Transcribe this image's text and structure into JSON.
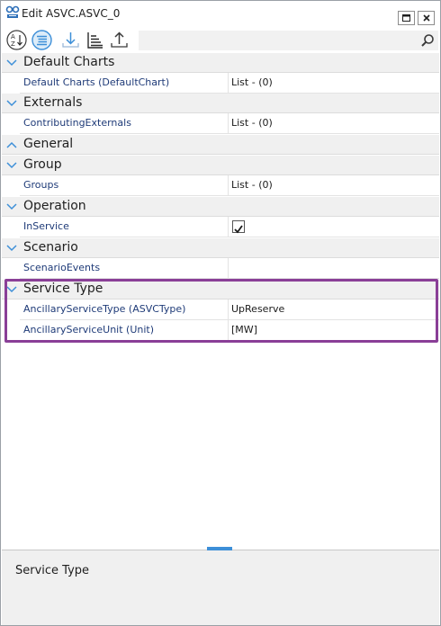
{
  "window": {
    "title": "Edit ASVC.ASVC_0"
  },
  "toolbar": {
    "buttons": [
      "sort-alphabetical",
      "sort-categorized",
      "download",
      "hierarchy",
      "upload"
    ],
    "search": {
      "placeholder": "",
      "value": ""
    }
  },
  "categories": [
    {
      "label": "Default Charts",
      "expanded": true,
      "rows": [
        {
          "name": "Default Charts (DefaultChart)",
          "value": "List - (0)"
        }
      ]
    },
    {
      "label": "Externals",
      "expanded": true,
      "rows": [
        {
          "name": "ContributingExternals",
          "value": "List - (0)"
        }
      ]
    },
    {
      "label": "General",
      "expanded": false,
      "rows": []
    },
    {
      "label": "Group",
      "expanded": true,
      "rows": [
        {
          "name": "Groups",
          "value": "List - (0)"
        }
      ]
    },
    {
      "label": "Operation",
      "expanded": true,
      "rows": [
        {
          "name": "InService",
          "value": "",
          "checked": true
        }
      ]
    },
    {
      "label": "Scenario",
      "expanded": true,
      "rows": [
        {
          "name": "ScenarioEvents",
          "value": ""
        }
      ]
    },
    {
      "label": "Service Type",
      "expanded": true,
      "highlighted": true,
      "rows": [
        {
          "name": "AncillaryServiceType (ASVCType)",
          "value": "UpReserve"
        },
        {
          "name": "AncillaryServiceUnit (Unit)",
          "value": "[MW]"
        }
      ]
    }
  ],
  "description": {
    "title": "Service Type"
  },
  "colors": {
    "accent": "#3d8fd8",
    "highlight_border": "#8a3f97",
    "category_bg": "#f0f0f0"
  }
}
